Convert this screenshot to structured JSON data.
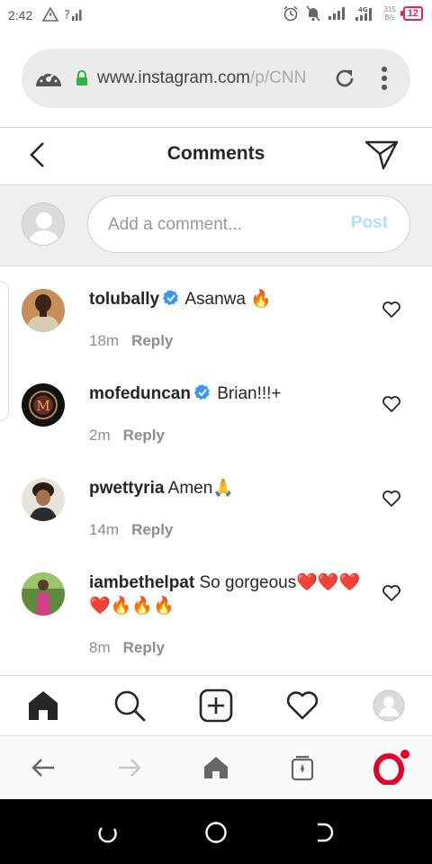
{
  "status_bar": {
    "time": "2:42",
    "network_speed_value": "315",
    "network_speed_unit": "B/s",
    "battery": "12",
    "network_type": "4G"
  },
  "browser": {
    "url_main": "www.instagram.com",
    "url_path": "/p/CNN",
    "icons": [
      "speed-dial-icon",
      "lock-icon",
      "reload-icon",
      "more-vert-icon"
    ]
  },
  "header": {
    "title": "Comments"
  },
  "add_comment": {
    "placeholder": "Add a comment...",
    "post_label": "Post"
  },
  "comments": [
    {
      "username": "tolubally",
      "verified": true,
      "text": "Asanwa 🔥",
      "time": "18m",
      "reply_label": "Reply"
    },
    {
      "username": "mofeduncan",
      "verified": true,
      "text": "Brian!!!+",
      "time": "2m",
      "reply_label": "Reply"
    },
    {
      "username": "pwettyria",
      "verified": false,
      "text": "Amen🙏",
      "time": "14m",
      "reply_label": "Reply"
    },
    {
      "username": "iambethelpat",
      "verified": false,
      "text": "So gorgeous❤️❤️❤️❤️🔥🔥🔥",
      "time": "8m",
      "reply_label": "Reply"
    }
  ],
  "ig_nav": [
    "home-icon",
    "search-icon",
    "new-post-icon",
    "activity-heart-icon",
    "profile-avatar"
  ],
  "browser_nav": [
    "back-arrow-icon",
    "forward-arrow-icon",
    "home-icon",
    "tabs-icon",
    "opera-icon"
  ],
  "android_nav": [
    "recents-icon",
    "home-circle-icon",
    "back-icon"
  ],
  "colors": {
    "accent_blue": "#3897f0",
    "post_disabled": "#b2dffc",
    "battery_red": "#e0245e",
    "opera_red": "#e0002a"
  }
}
